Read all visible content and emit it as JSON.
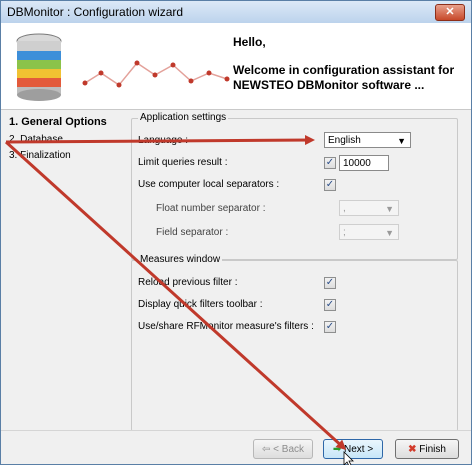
{
  "window": {
    "title": "DBMonitor : Configuration wizard",
    "close_glyph": "✕"
  },
  "banner": {
    "hello": "Hello,",
    "welcome_line1": "Welcome in configuration assistant for",
    "welcome_line2": "NEWSTEO DBMonitor software ..."
  },
  "nav": {
    "items": [
      {
        "label": "1. General Options",
        "active": true
      },
      {
        "label": "2. Database",
        "active": false
      },
      {
        "label": "3. Finalization",
        "active": false
      }
    ]
  },
  "application_settings": {
    "title": "Application settings",
    "language_label": "Language :",
    "language_value": "English",
    "limit_label": "Limit queries result :",
    "limit_checked": true,
    "limit_value": "10000",
    "local_sep_label": "Use computer local separators :",
    "local_sep_checked": true,
    "float_sep_label": "Float number separator :",
    "float_sep_value": ",",
    "field_sep_label": "Field separator :",
    "field_sep_value": ";"
  },
  "measures_window": {
    "title": "Measures window",
    "reload_label": "Reload previous filter :",
    "reload_checked": true,
    "quick_filters_label": "Display quick filters toolbar :",
    "quick_filters_checked": true,
    "share_label": "Use/share RFMonitor measure's filters :",
    "share_checked": true
  },
  "footer": {
    "back_label": "< Back",
    "next_label": "Next >",
    "finish_label": "Finish"
  },
  "check_glyph": "✓",
  "dropdown_glyph": "▼",
  "colors": {
    "annotation_arrow": "#c0392b",
    "next_accent": "#2b9a2b",
    "finish_x": "#d23a2a"
  }
}
